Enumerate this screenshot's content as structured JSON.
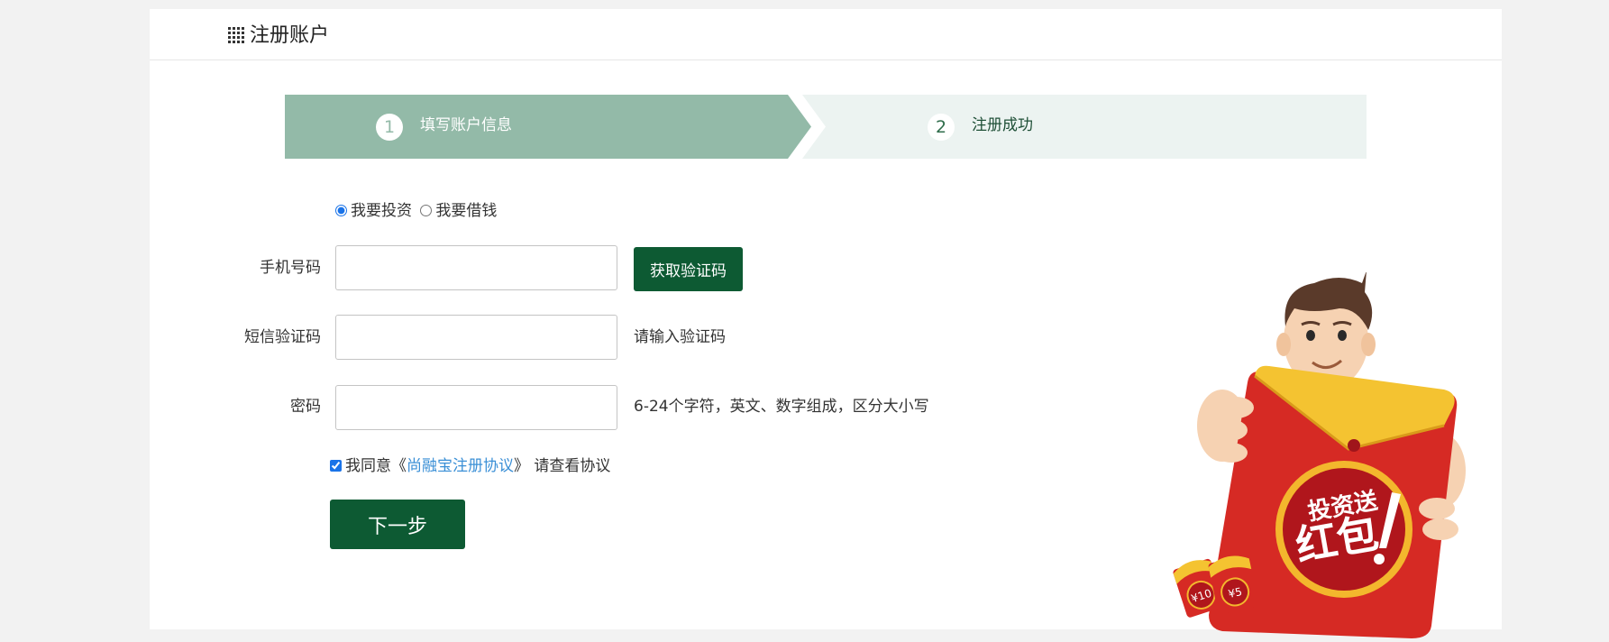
{
  "header": {
    "title": "注册账户",
    "icon": "grid-icon"
  },
  "steps": [
    {
      "number": "1",
      "label": "填写账户信息",
      "active": true
    },
    {
      "number": "2",
      "label": "注册成功",
      "active": false
    }
  ],
  "colors": {
    "step_active_bg": "#93baa8",
    "step_inactive_bg": "#ecf3f1",
    "primary_button": "#0d5a33",
    "link": "#3a8fd6"
  },
  "role": {
    "options": [
      "我要投资",
      "我要借钱"
    ],
    "selected": "我要投资"
  },
  "form": {
    "phone": {
      "label": "手机号码",
      "value": "",
      "button": "获取验证码"
    },
    "sms_code": {
      "label": "短信验证码",
      "value": "",
      "hint": "请输入验证码"
    },
    "password": {
      "label": "密码",
      "value": "",
      "hint": "6-24个字符，英文、数字组成，区分大小写"
    }
  },
  "agreement": {
    "checked": true,
    "prefix": "我同意《",
    "link": "尚融宝注册协议",
    "suffix": "》 请查看协议"
  },
  "next_button": "下一步",
  "promo": {
    "badge_line1": "投资送",
    "badge_line2": "红包",
    "envelope1": "¥10",
    "envelope2": "¥5"
  }
}
